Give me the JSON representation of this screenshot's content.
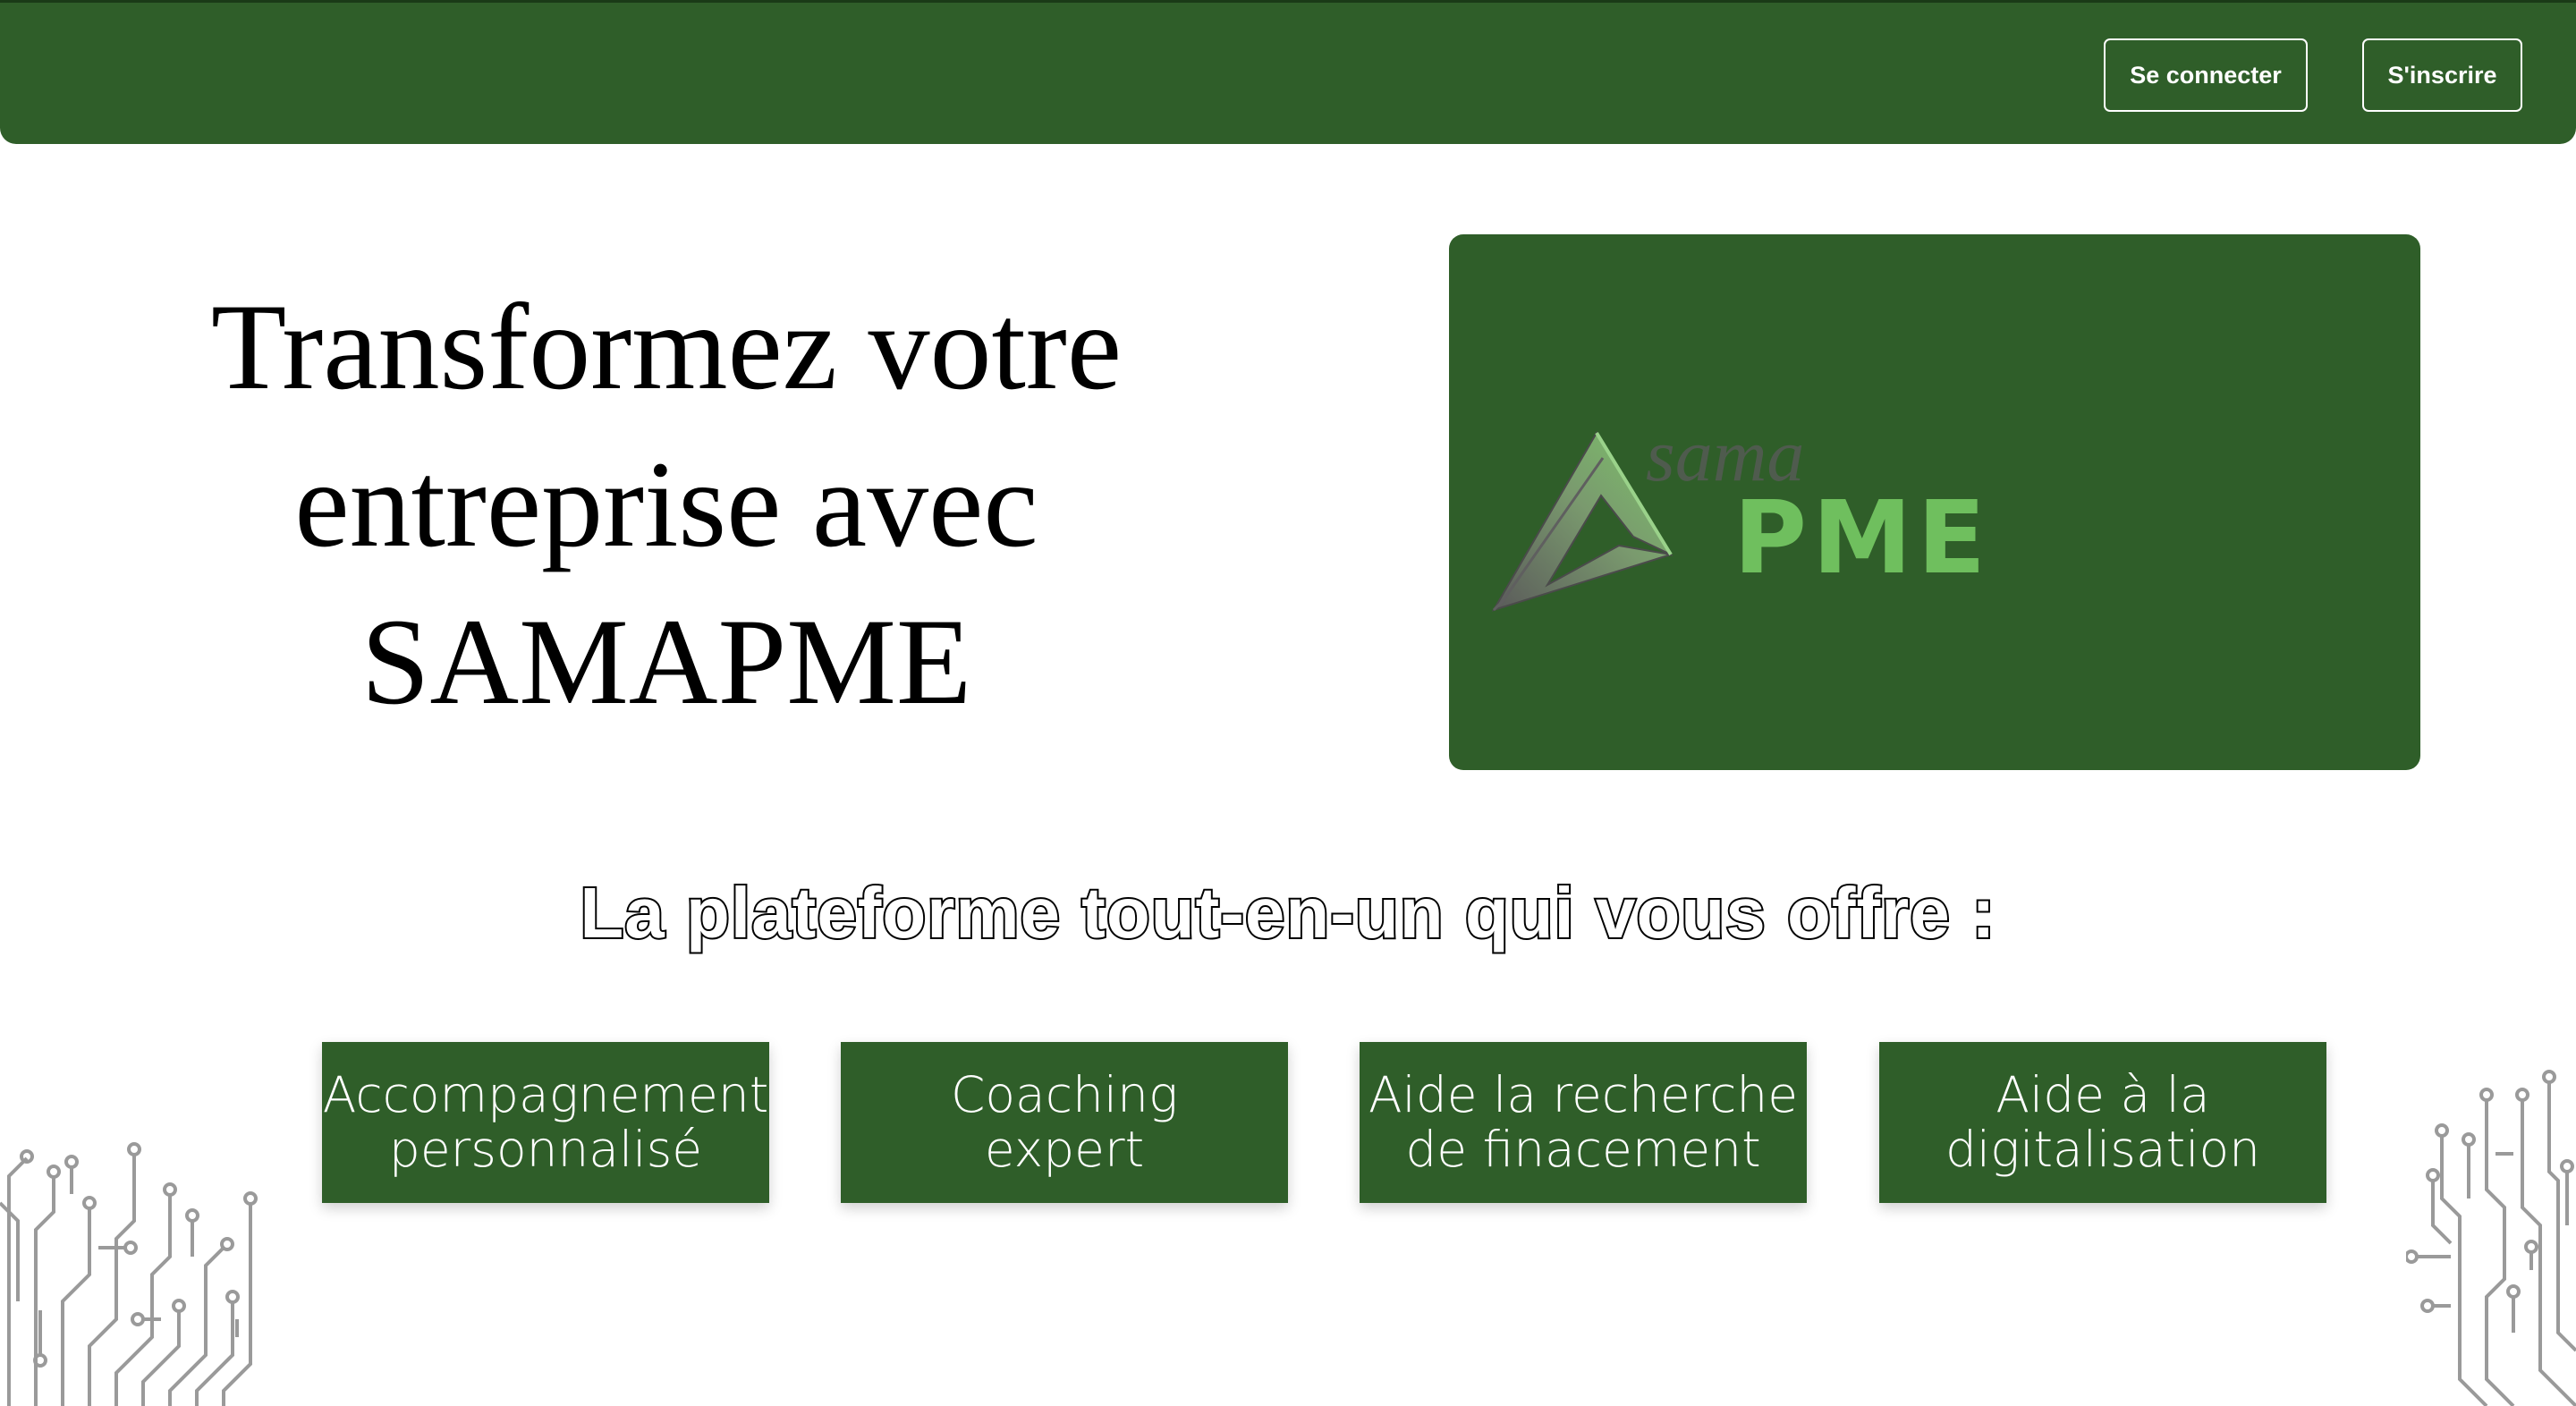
{
  "header": {
    "login_label": "Se connecter",
    "signup_label": "S'inscrire"
  },
  "hero": {
    "title_line1": "Transformez votre",
    "title_line2": "entreprise avec",
    "title_line3": "SAMAPME"
  },
  "logo": {
    "small_text": "sama",
    "main_text": "PME"
  },
  "tagline": "La plateforme tout-en-un qui vous offre :",
  "features": [
    {
      "line1": "Accompagnement",
      "line2": "personnalisé"
    },
    {
      "line1": "Coaching",
      "line2": "expert"
    },
    {
      "line1": "Aide la recherche",
      "line2": "de finacement"
    },
    {
      "line1": "Aide à la",
      "line2": "digitalisation"
    }
  ],
  "colors": {
    "brand_green": "#2f5e29",
    "logo_light_green": "#6fbf5e",
    "white": "#ffffff"
  }
}
